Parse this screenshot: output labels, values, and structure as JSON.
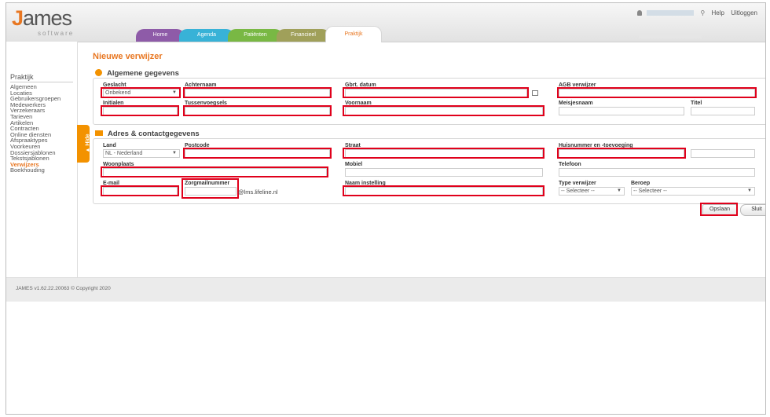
{
  "app": {
    "logo_main_rest": "ames",
    "logo_j": "J",
    "logo_sub": "software"
  },
  "nav": {
    "tabs": [
      {
        "label": "Home"
      },
      {
        "label": "Agenda"
      },
      {
        "label": "Patiënten"
      },
      {
        "label": "Financieel"
      },
      {
        "label": "Praktijk"
      }
    ]
  },
  "userbar": {
    "help": "Help",
    "logout": "Uitloggen"
  },
  "sidebar": {
    "title": "Praktijk",
    "items": [
      {
        "label": "Algemeen"
      },
      {
        "label": "Locaties"
      },
      {
        "label": "Gebruikersgroepen"
      },
      {
        "label": "Medewerkers"
      },
      {
        "label": "Verzekeraars"
      },
      {
        "label": "Tarieven"
      },
      {
        "label": "Artikelen"
      },
      {
        "label": "Contracten"
      },
      {
        "label": "Online diensten"
      },
      {
        "label": "Afspraaktypes"
      },
      {
        "label": "Voorkeuren"
      },
      {
        "label": "Dossiersjablonen"
      },
      {
        "label": "Tekstsjablonen"
      },
      {
        "label": "Verwijzers"
      },
      {
        "label": "Boekhouding"
      }
    ],
    "hide_label": "▲ Hide"
  },
  "page": {
    "title": "Nieuwe verwijzer"
  },
  "general": {
    "title": "Algemene gegevens",
    "geslacht_label": "Geslacht",
    "geslacht_value": "Onbekend",
    "achternaam_label": "Achternaam",
    "gbrt_label": "Gbrt. datum",
    "agb_label": "AGB verwijzer",
    "initialen_label": "Initialen",
    "tussenvoegsels_label": "Tussenvoegsels",
    "voornaam_label": "Voornaam",
    "meisjesnaam_label": "Meisjesnaam",
    "titel_label": "Titel"
  },
  "address": {
    "title": "Adres & contactgegevens",
    "land_label": "Land",
    "land_value": "NL - Nederland",
    "postcode_label": "Postcode",
    "straat_label": "Straat",
    "huisnummer_label": "Huisnummer en -toevoeging",
    "woonplaats_label": "Woonplaats",
    "mobiel_label": "Mobiel",
    "telefoon_label": "Telefoon",
    "email_label": "E-mail",
    "zorgmail_label": "Zorgmailnummer",
    "zorgmail_suffix": "@lms.lifeline.nl",
    "naam_instelling_label": "Naam instelling",
    "type_label": "Type verwijzer",
    "type_value": "-- Selecteer --",
    "beroep_label": "Beroep",
    "beroep_value": "-- Selecteer --"
  },
  "actions": {
    "save": "Opslaan",
    "close": "Sluit"
  },
  "footer": {
    "text": "JAMES v1.62.22.20063 © Copyright 2020"
  },
  "colors": {
    "accent": "#e87722",
    "highlight": "#e0001b"
  }
}
